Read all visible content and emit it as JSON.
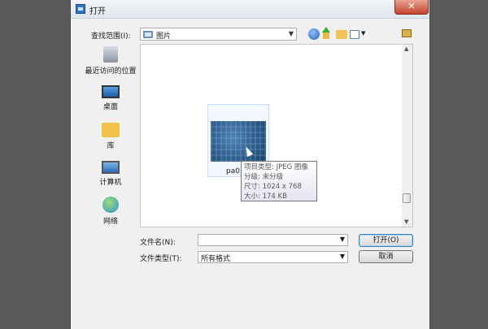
{
  "window": {
    "title": "打开",
    "close_glyph": "✕"
  },
  "toolbar": {
    "lookin_label": "查找范围(I):",
    "lookin_value": "图片",
    "icons": [
      "back-icon",
      "up-folder-icon",
      "new-folder-icon",
      "view-menu-icon",
      "folder-icon"
    ]
  },
  "places": [
    {
      "label": "最近访问的位置",
      "icon": "recent-places-icon"
    },
    {
      "label": "桌面",
      "icon": "desktop-icon"
    },
    {
      "label": "库",
      "icon": "library-icon"
    },
    {
      "label": "计算机",
      "icon": "computer-icon"
    },
    {
      "label": "网络",
      "icon": "network-icon"
    }
  ],
  "file": {
    "name": "pa0"
  },
  "tooltip": {
    "type": "项目类型: JPEG 图像",
    "rating": "分级: 未分级",
    "dimensions": "尺寸: 1024 x 768",
    "size": "大小: 174 KB"
  },
  "bottom": {
    "filename_label": "文件名(N):",
    "filename_value": "",
    "filetype_label": "文件类型(T):",
    "filetype_value": "所有格式",
    "open_label": "打开(O)",
    "cancel_label": "取消"
  },
  "colors": {
    "accent": "#3c7fb1",
    "close": "#c2442c",
    "background": "#5a5a5a"
  }
}
